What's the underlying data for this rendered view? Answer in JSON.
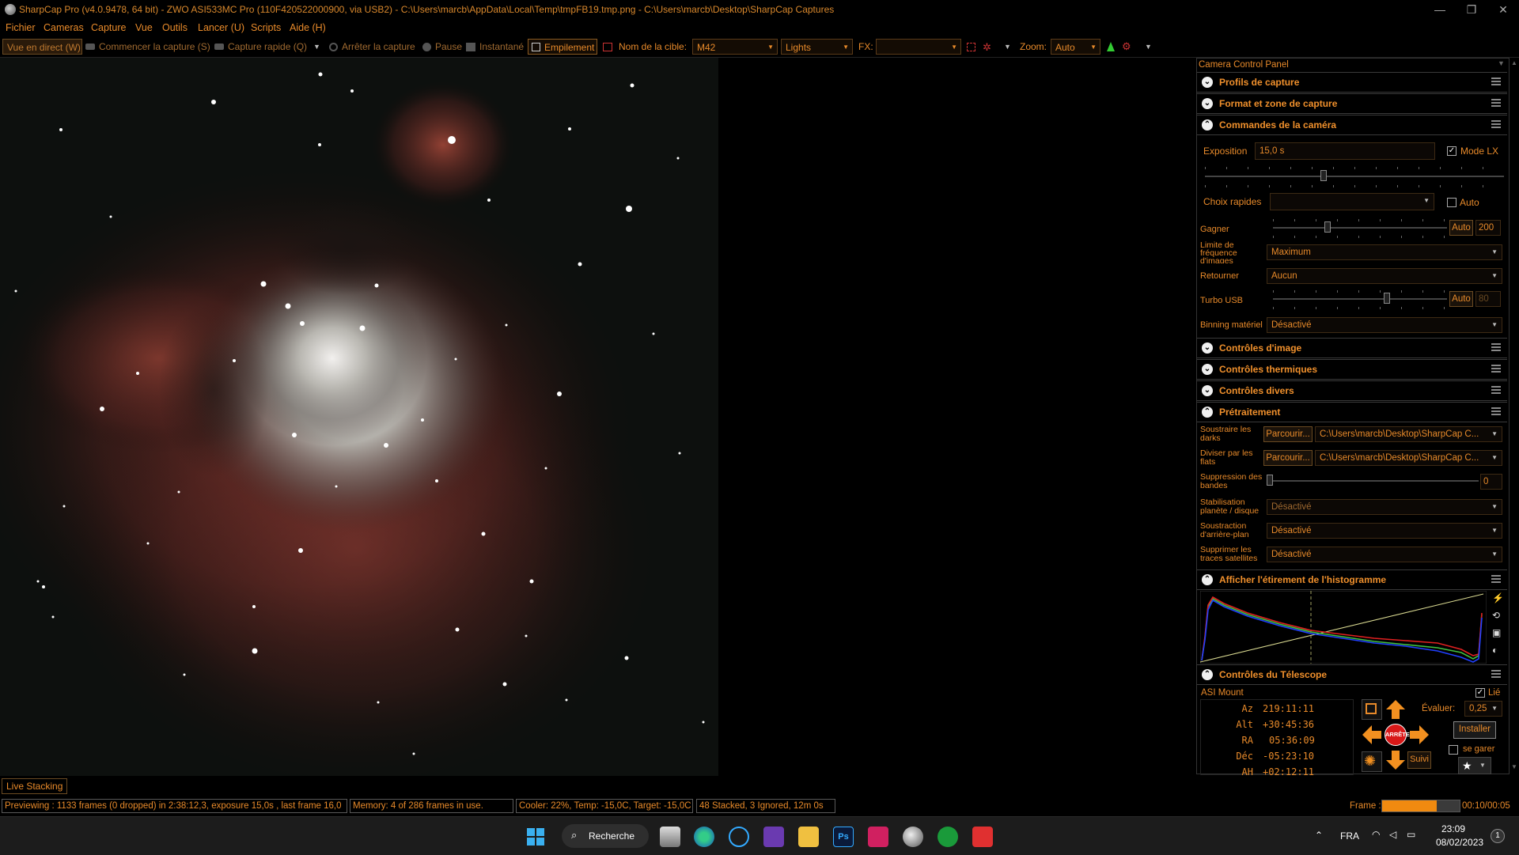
{
  "window": {
    "title": "SharpCap Pro (v4.0.9478, 64 bit) - ZWO ASI533MC Pro (110F420522000900, via USB2) - C:\\Users\\marcb\\AppData\\Local\\Temp\\tmpFB19.tmp.png - C:\\Users\\marcb\\Desktop\\SharpCap Captures",
    "minimize": "—",
    "maximize": "❐",
    "close": "✕"
  },
  "menu": [
    "Fichier",
    "Cameras",
    "Capture",
    "Vue",
    "Outils",
    "Lancer (U)",
    "Scripts",
    "Aide (H)"
  ],
  "toolbar": {
    "live_view": "Vue en direct (W)",
    "start_capture": "Commencer la capture (S)",
    "quick_capture": "Capture rapide (Q)",
    "stop_capture": "Arrêter la capture",
    "pause": "Pause",
    "snapshot": "Instantané",
    "stacking": "Empilement",
    "target_label": "Nom de la cible:",
    "target_value": "M42",
    "frame_type": "Lights",
    "fx_label": "FX:",
    "fx_value": "",
    "zoom_label": "Zoom:",
    "zoom_value": "Auto"
  },
  "panel": {
    "title": "Camera Control Panel",
    "sections": {
      "profiles": "Profils de capture",
      "format": "Format et zone de capture",
      "camera": "Commandes de la caméra",
      "image": "Contrôles d'image",
      "thermal": "Contrôles thermiques",
      "misc": "Contrôles divers",
      "preprocess": "Prétraitement",
      "histogram": "Afficher l'étirement de l'histogramme",
      "telescope": "Contrôles du Télescope"
    },
    "camera": {
      "exposure_label": "Exposition",
      "exposure_value": "15,0 s",
      "lx_mode_label": "Mode LX",
      "lx_mode_checked": true,
      "quick_choice_label": "Choix rapides",
      "quick_choice_value": "",
      "auto_label": "Auto",
      "gain_label": "Gagner",
      "gain_auto": "Auto",
      "gain_value": "200",
      "framerate_label": "Limite de fréquence d'images",
      "framerate_value": "Maximum",
      "flip_label": "Retourner",
      "flip_value": "Aucun",
      "usb_label": "Turbo USB",
      "usb_auto": "Auto",
      "usb_value": "80",
      "binning_label": "Binning matériel",
      "binning_value": "Désactivé"
    },
    "preprocess": {
      "darks_label": "Soustraire les darks",
      "darks_button": "Parcourir...",
      "darks_path": "C:\\Users\\marcb\\Desktop\\SharpCap C...",
      "flats_label": "Diviser par les flats",
      "flats_button": "Parcourir...",
      "flats_path": "C:\\Users\\marcb\\Desktop\\SharpCap C...",
      "banding_label": "Suppression des bandes",
      "banding_value": "0",
      "stabilization_label": "Stabilisation planète / disque",
      "stabilization_value": "Désactivé",
      "background_label": "Soustraction d'arrière-plan",
      "background_value": "Désactivé",
      "satellite_label": "Supprimer les traces satellites",
      "satellite_value": "Désactivé"
    },
    "telescope": {
      "mount_name": "ASI Mount",
      "linked_label": "Lié",
      "linked_checked": true,
      "coords": [
        {
          "label": "Az",
          "value": "219:11:11"
        },
        {
          "label": "Alt",
          "value": "+30:45:36"
        },
        {
          "label": "RA",
          "value": "05:36:09"
        },
        {
          "label": "Déc",
          "value": "-05:23:10"
        },
        {
          "label": "AH",
          "value": "+02:12:11"
        }
      ],
      "rate_label": "Évaluer:",
      "rate_value": "0,25",
      "setup_button": "Installer",
      "park_label": "se garer",
      "stop_label": "ARRÊTE",
      "tracking_label": "Suivi"
    }
  },
  "status": {
    "live_stacking_tab": "Live Stacking",
    "preview": "Previewing : 1133 frames (0 dropped) in 2:38:12,3, exposure 15,0s , last frame 16,0",
    "memory": "Memory: 4 of 286 frames in use.",
    "cooler": "Cooler: 22%, Temp: -15,0C, Target: -15,0C",
    "stacked": "48 Stacked, 3 Ignored, 12m 0s",
    "frame_label": "Frame :",
    "frame_progress": 0.7,
    "frame_time": "00:10/00:05"
  },
  "taskbar": {
    "search": "Recherche",
    "lang": "FRA",
    "time": "23:09",
    "date": "08/02/2023",
    "notif_count": "1"
  },
  "colors": {
    "accent": "#e88a2a",
    "hist_red": "#e02020",
    "hist_blue": "#2040ff",
    "hist_line": "#d8d890"
  }
}
